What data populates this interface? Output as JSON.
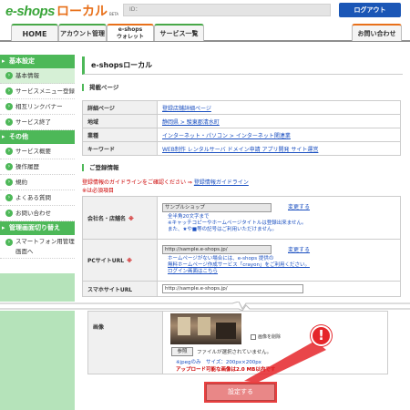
{
  "header": {
    "logo_main": "e-shops",
    "logo_sub": "ローカル",
    "logo_small": "BETA",
    "id_label": "ID：",
    "logout_label": "ログアウト"
  },
  "tabs": {
    "home": "HOME",
    "account": "アカウント管理",
    "wallet_line1": "e-shops",
    "wallet_line2": "ウォレット",
    "services": "サービス一覧",
    "contact": "お問い合わせ"
  },
  "sidebar": {
    "group1": "基本設定",
    "group1_items": [
      "基本情報",
      "サービスメニュー登録",
      "相互リンクバナー",
      "サービス終了"
    ],
    "group2": "その他",
    "group2_items": [
      "サービス概要",
      "操作履歴",
      "規約",
      "よくある質問",
      "お問い合わせ"
    ],
    "group3": "管理画面切り替え",
    "group3_item_line1": "スマートフォン用管理",
    "group3_item_line2": "画面へ"
  },
  "main": {
    "title": "e-shopsローカル",
    "listing_head": "掲載ページ",
    "listing_rows": [
      {
        "key": "詳細ページ",
        "value": "登録店舗詳細ページ"
      },
      {
        "key": "地域",
        "value": "静岡県 > 駿東郡清水町"
      },
      {
        "key": "業種",
        "value": "インターネット・パソコン > インターネット関連業"
      },
      {
        "key": "キーワード",
        "value": "WEB制作 レンタルサーバ ドメイン申請 アプリ開発 サイト運営"
      }
    ],
    "reg_head": "ご登録情報",
    "guide_note": "登録情報のガイドラインをご確認ください ⇒ ",
    "guide_link": "登録情報ガイドライン",
    "required_note": "※は必須項目",
    "form": {
      "shop_name_label": "会社名・店舗名",
      "required_mark": "※",
      "shop_name_value": "サンプルショップ",
      "change_label": "変更する",
      "shop_hint1": "全半角20文字まで",
      "shop_hint2": "※キャッチコピーやホームページタイトルは登録出来ません。",
      "shop_hint3": "また、★や■等の記号はご利用いただけません。",
      "pc_url_label": "PCサイトURL",
      "pc_url_value": "http://sample.e-shops.jp/",
      "pc_hint1": "ホームページがない場合には、e-shops 提供の",
      "pc_hint2": "無料ホームページ作成サービス「crayon」をご利用ください。",
      "pc_hint3": "ログイン画面はこちら",
      "sp_url_label": "スマホサイトURL",
      "sp_url_value": "http://sample.e-shops.jp/",
      "image_label": "画像",
      "delete_image": "画像を削除",
      "file_button": "参照",
      "file_none": "ファイルが選択されていません。",
      "image_spec": "※jpegのみ　サイズ：200px×200px",
      "image_max": "アップロード可能な画像は2.0 MB以内です"
    },
    "save_label": "設定する"
  },
  "colors": {
    "brand_green": "#4db858",
    "logout_blue": "#1a56b6",
    "alert_red": "#e5262a"
  }
}
